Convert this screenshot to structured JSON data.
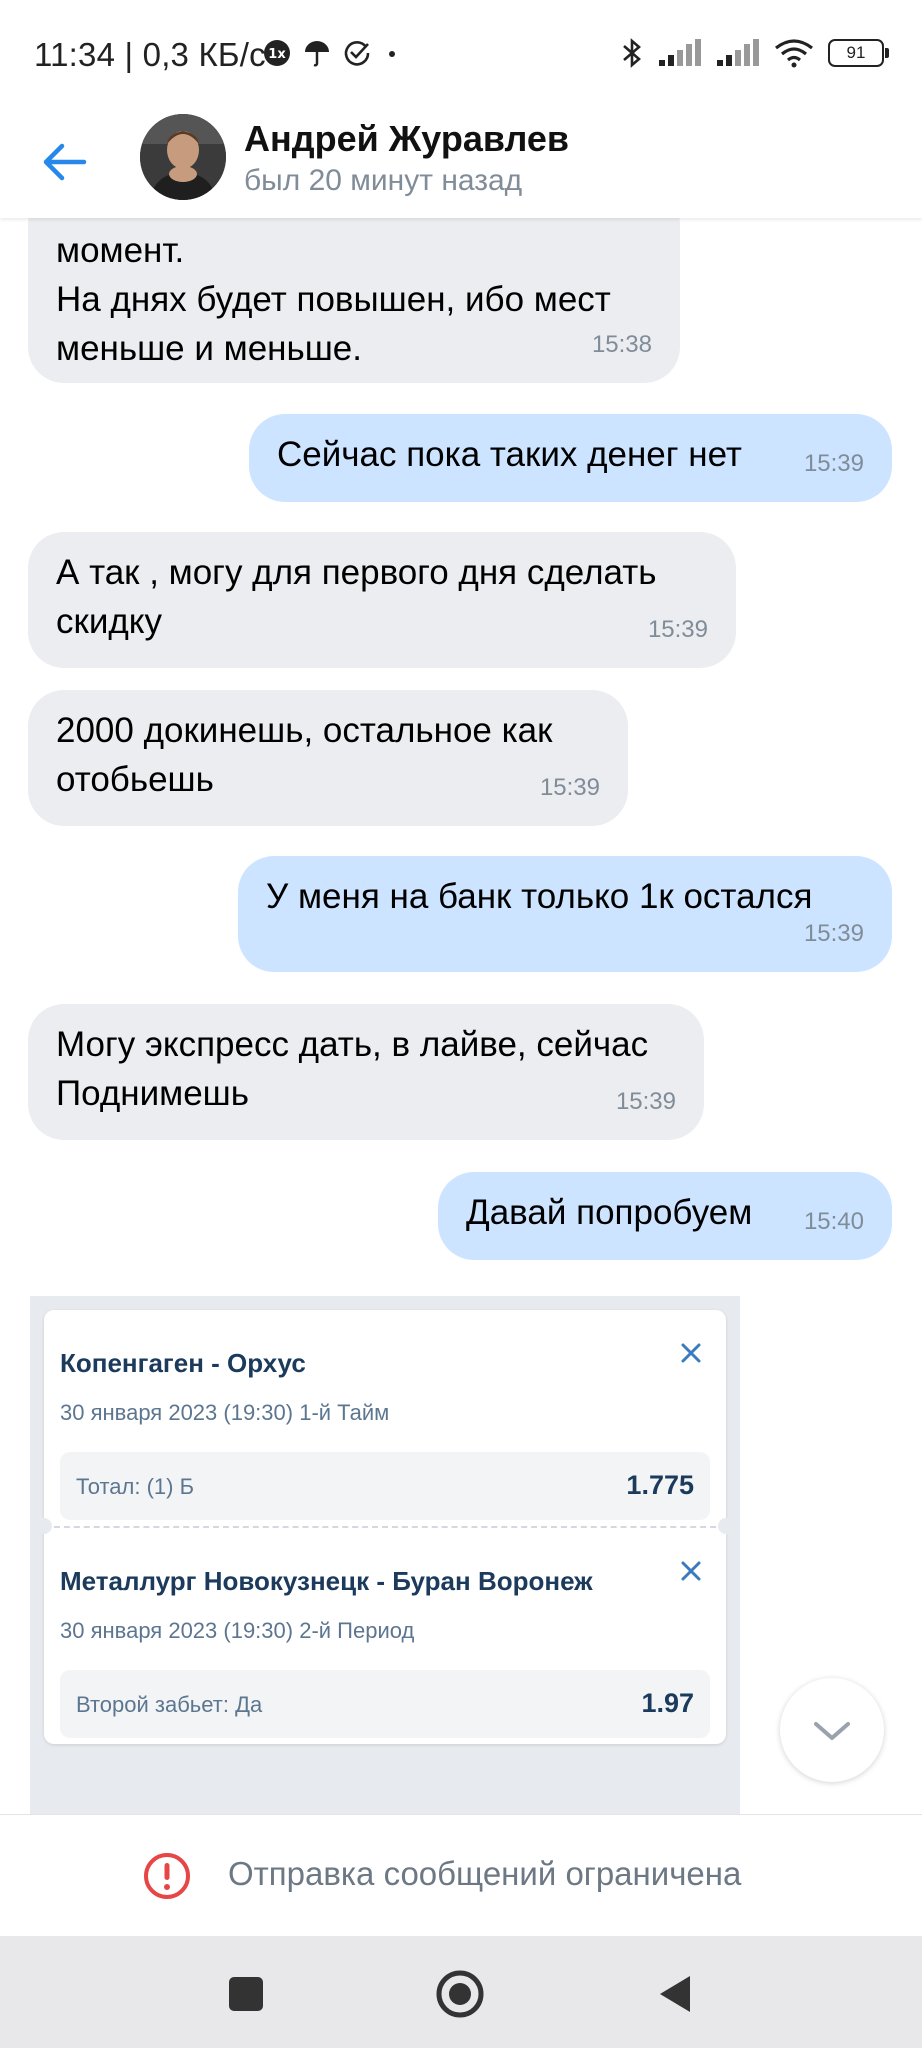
{
  "status_bar": {
    "time": "11:34 | 0,3 КБ/с",
    "battery": "91"
  },
  "header": {
    "contact_name": "Андрей Журавлев",
    "contact_status": "был 20 минут назад"
  },
  "messages": [
    {
      "dir": "in",
      "text": "момент.\nНа днях будет повышен, ибо мест\nменьше и меньше.",
      "time": "15:38"
    },
    {
      "dir": "out",
      "text": "Сейчас пока таких денег нет",
      "time": "15:39"
    },
    {
      "dir": "in",
      "text": "А так , могу для первого дня сделать\nскидку",
      "time": "15:39"
    },
    {
      "dir": "in",
      "text": "2000 докинешь, остальное как\nотобьешь",
      "time": "15:39"
    },
    {
      "dir": "out",
      "text": "У меня на банк только 1к остался",
      "time": "15:39"
    },
    {
      "dir": "in",
      "text": "Могу экспресс дать, в лайве, сейчас\nПоднимешь",
      "time": "15:39"
    },
    {
      "dir": "out",
      "text": "Давай попробуем",
      "time": "15:40"
    }
  ],
  "coupon": {
    "bets": [
      {
        "match": "Копенгаген - Орхус",
        "date": "30 января 2023 (19:30) 1-й Тайм",
        "market": "Тотал: (1) Б",
        "odd": "1.775"
      },
      {
        "match": "Металлург Новокузнецк - Буран Воронеж",
        "date": "30 января 2023 (19:30) 2-й Период",
        "market": "Второй забьет: Да",
        "odd": "1.97"
      }
    ]
  },
  "footer": {
    "restriction_text": "Отправка сообщений ограничена"
  },
  "colors": {
    "accent": "#2688eb",
    "incoming_bubble": "#ebedf0",
    "outgoing_bubble": "#cce4ff",
    "error": "#e64646"
  }
}
